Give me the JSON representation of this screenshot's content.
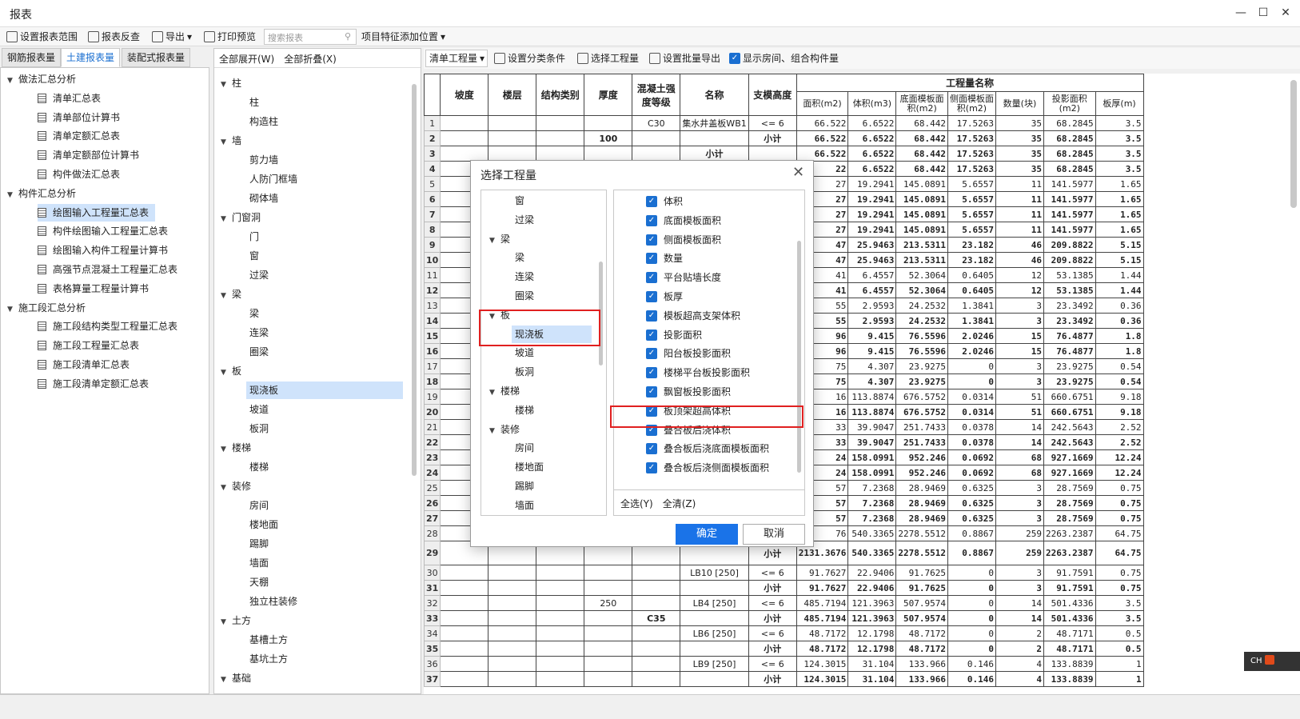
{
  "app_title": "报表",
  "toolbar": {
    "set_range": "设置报表范围",
    "reverse": "报表反查",
    "export": "导出",
    "print": "打印预览",
    "search_placeholder": "搜索报表",
    "feature_pos": "项目特征添加位置"
  },
  "tabs": [
    "钢筋报表量",
    "土建报表量",
    "装配式报表量"
  ],
  "left_tree": [
    {
      "label": "做法汇总分析",
      "group": true
    },
    {
      "label": "清单汇总表"
    },
    {
      "label": "清单部位计算书"
    },
    {
      "label": "清单定额汇总表"
    },
    {
      "label": "清单定额部位计算书"
    },
    {
      "label": "构件做法汇总表"
    },
    {
      "label": "构件汇总分析",
      "group": true
    },
    {
      "label": "绘图输入工程量汇总表",
      "selected": true
    },
    {
      "label": "构件绘图输入工程量汇总表"
    },
    {
      "label": "绘图输入构件工程量计算书"
    },
    {
      "label": "高强节点混凝土工程量汇总表"
    },
    {
      "label": "表格算量工程量计算书"
    },
    {
      "label": "施工段汇总分析",
      "group": true
    },
    {
      "label": "施工段结构类型工程量汇总表"
    },
    {
      "label": "施工段工程量汇总表"
    },
    {
      "label": "施工段清单汇总表"
    },
    {
      "label": "施工段清单定额汇总表"
    }
  ],
  "mid_head": {
    "expand": "全部展开(W)",
    "collapse": "全部折叠(X)"
  },
  "mid_tree": [
    {
      "label": "柱",
      "group": true
    },
    {
      "label": "柱"
    },
    {
      "label": "构造柱"
    },
    {
      "label": "墙",
      "group": true
    },
    {
      "label": "剪力墙"
    },
    {
      "label": "人防门框墙"
    },
    {
      "label": "砌体墙"
    },
    {
      "label": "门窗洞",
      "group": true
    },
    {
      "label": "门"
    },
    {
      "label": "窗"
    },
    {
      "label": "过梁"
    },
    {
      "label": "梁",
      "group": true
    },
    {
      "label": "梁"
    },
    {
      "label": "连梁"
    },
    {
      "label": "圈梁"
    },
    {
      "label": "板",
      "group": true
    },
    {
      "label": "现浇板",
      "selected": true
    },
    {
      "label": "坡道"
    },
    {
      "label": "板洞"
    },
    {
      "label": "楼梯",
      "group": true
    },
    {
      "label": "楼梯"
    },
    {
      "label": "装修",
      "group": true
    },
    {
      "label": "房间"
    },
    {
      "label": "楼地面"
    },
    {
      "label": "踢脚"
    },
    {
      "label": "墙面"
    },
    {
      "label": "天棚"
    },
    {
      "label": "独立柱装修"
    },
    {
      "label": "土方",
      "group": true
    },
    {
      "label": "基槽土方"
    },
    {
      "label": "基坑土方"
    },
    {
      "label": "基础",
      "group": true
    }
  ],
  "right_toolbar": {
    "combo": "清单工程量",
    "classify": "设置分类条件",
    "select_qty": "选择工程量",
    "batch_export": "设置批量导出",
    "show_room": "显示房间、组合构件量"
  },
  "table": {
    "headers": [
      "坡度",
      "楼层",
      "结构类别",
      "厚度",
      "混凝土强度等级",
      "名称",
      "支模高度"
    ],
    "group_header": "工程量名称",
    "qty_headers": [
      "面积(m2)",
      "体积(m3)",
      "底面模板面积(m2)",
      "侧面模板面积(m2)",
      "数量(块)",
      "投影面积(m2)",
      "板厚(m)"
    ],
    "rows": [
      {
        "thick": "",
        "grade": "C30",
        "name": "集水井盖板WB1",
        "h": "<= 6",
        "v": [
          "66.522",
          "6.6522",
          "68.442",
          "17.5263",
          "35",
          "68.2845",
          "3.5"
        ]
      },
      {
        "thick": "100",
        "grade": "",
        "name": "",
        "h": "小计",
        "v": [
          "66.522",
          "6.6522",
          "68.442",
          "17.5263",
          "35",
          "68.2845",
          "3.5"
        ],
        "bold": true
      },
      {
        "thick": "",
        "grade": "",
        "name": "小计",
        "h": "",
        "v": [
          "66.522",
          "6.6522",
          "68.442",
          "17.5263",
          "35",
          "68.2845",
          "3.5"
        ],
        "bold": true
      },
      {
        "v": [
          "22",
          "6.6522",
          "68.442",
          "17.5263",
          "35",
          "68.2845",
          "3.5"
        ],
        "bold": true
      },
      {
        "v": [
          "27",
          "19.2941",
          "145.0891",
          "5.6557",
          "11",
          "141.5977",
          "1.65"
        ]
      },
      {
        "v": [
          "27",
          "19.2941",
          "145.0891",
          "5.6557",
          "11",
          "141.5977",
          "1.65"
        ],
        "bold": true
      },
      {
        "v": [
          "27",
          "19.2941",
          "145.0891",
          "5.6557",
          "11",
          "141.5977",
          "1.65"
        ],
        "bold": true
      },
      {
        "v": [
          "27",
          "19.2941",
          "145.0891",
          "5.6557",
          "11",
          "141.5977",
          "1.65"
        ],
        "bold": true
      },
      {
        "v": [
          "47",
          "25.9463",
          "213.5311",
          "23.182",
          "46",
          "209.8822",
          "5.15"
        ],
        "bold": true
      },
      {
        "v": [
          "47",
          "25.9463",
          "213.5311",
          "23.182",
          "46",
          "209.8822",
          "5.15"
        ],
        "bold": true
      },
      {
        "v": [
          "41",
          "6.4557",
          "52.3064",
          "0.6405",
          "12",
          "53.1385",
          "1.44"
        ]
      },
      {
        "v": [
          "41",
          "6.4557",
          "52.3064",
          "0.6405",
          "12",
          "53.1385",
          "1.44"
        ],
        "bold": true
      },
      {
        "v": [
          "55",
          "2.9593",
          "24.2532",
          "1.3841",
          "3",
          "23.3492",
          "0.36"
        ]
      },
      {
        "v": [
          "55",
          "2.9593",
          "24.2532",
          "1.3841",
          "3",
          "23.3492",
          "0.36"
        ],
        "bold": true
      },
      {
        "v": [
          "96",
          "9.415",
          "76.5596",
          "2.0246",
          "15",
          "76.4877",
          "1.8"
        ],
        "bold": true
      },
      {
        "v": [
          "96",
          "9.415",
          "76.5596",
          "2.0246",
          "15",
          "76.4877",
          "1.8"
        ],
        "bold": true
      },
      {
        "v": [
          "75",
          "4.307",
          "23.9275",
          "0",
          "3",
          "23.9275",
          "0.54"
        ]
      },
      {
        "v": [
          "75",
          "4.307",
          "23.9275",
          "0",
          "3",
          "23.9275",
          "0.54"
        ],
        "bold": true
      },
      {
        "v": [
          "16",
          "113.8874",
          "676.5752",
          "0.0314",
          "51",
          "660.6751",
          "9.18"
        ]
      },
      {
        "v": [
          "16",
          "113.8874",
          "676.5752",
          "0.0314",
          "51",
          "660.6751",
          "9.18"
        ],
        "bold": true
      },
      {
        "v": [
          "33",
          "39.9047",
          "251.7433",
          "0.0378",
          "14",
          "242.5643",
          "2.52"
        ]
      },
      {
        "v": [
          "33",
          "39.9047",
          "251.7433",
          "0.0378",
          "14",
          "242.5643",
          "2.52"
        ],
        "bold": true
      },
      {
        "v": [
          "24",
          "158.0991",
          "952.246",
          "0.0692",
          "68",
          "927.1669",
          "12.24"
        ],
        "bold": true
      },
      {
        "v": [
          "24",
          "158.0991",
          "952.246",
          "0.0692",
          "68",
          "927.1669",
          "12.24"
        ],
        "bold": true
      },
      {
        "v": [
          "57",
          "7.2368",
          "28.9469",
          "0.6325",
          "3",
          "28.7569",
          "0.75"
        ]
      },
      {
        "v": [
          "57",
          "7.2368",
          "28.9469",
          "0.6325",
          "3",
          "28.7569",
          "0.75"
        ],
        "bold": true
      },
      {
        "v": [
          "57",
          "7.2368",
          "28.9469",
          "0.6325",
          "3",
          "28.7569",
          "0.75"
        ],
        "bold": true
      },
      {
        "v": [
          "76",
          "540.3365",
          "2278.5512",
          "0.8867",
          "259",
          "2263.2387",
          "64.75"
        ]
      },
      {
        "thick": "",
        "grade": "",
        "name": "",
        "h": "小计",
        "v": [
          "2131.3676",
          "540.3365",
          "2278.5512",
          "0.8867",
          "259",
          "2263.2387",
          "64.75"
        ],
        "bold": true
      },
      {
        "thick": "",
        "grade": "",
        "name": "LB10 [250]",
        "h": "<= 6",
        "v": [
          "91.7627",
          "22.9406",
          "91.7625",
          "0",
          "3",
          "91.7591",
          "0.75"
        ]
      },
      {
        "thick": "",
        "grade": "",
        "name": "",
        "h": "小计",
        "v": [
          "91.7627",
          "22.9406",
          "91.7625",
          "0",
          "3",
          "91.7591",
          "0.75"
        ],
        "bold": true
      },
      {
        "thick": "250",
        "grade": "",
        "name": "LB4 [250]",
        "h": "<= 6",
        "v": [
          "485.7194",
          "121.3963",
          "507.9574",
          "0",
          "14",
          "501.4336",
          "3.5"
        ]
      },
      {
        "thick": "",
        "grade": "C35",
        "name": "",
        "h": "小计",
        "v": [
          "485.7194",
          "121.3963",
          "507.9574",
          "0",
          "14",
          "501.4336",
          "3.5"
        ],
        "bold": true
      },
      {
        "thick": "",
        "grade": "",
        "name": "LB6 [250]",
        "h": "<= 6",
        "v": [
          "48.7172",
          "12.1798",
          "48.7172",
          "0",
          "2",
          "48.7171",
          "0.5"
        ]
      },
      {
        "thick": "",
        "grade": "",
        "name": "",
        "h": "小计",
        "v": [
          "48.7172",
          "12.1798",
          "48.7172",
          "0",
          "2",
          "48.7171",
          "0.5"
        ],
        "bold": true
      },
      {
        "thick": "",
        "grade": "",
        "name": "LB9 [250]",
        "h": "<= 6",
        "v": [
          "124.3015",
          "31.104",
          "133.966",
          "0.146",
          "4",
          "133.8839",
          "1"
        ]
      },
      {
        "thick": "",
        "grade": "",
        "name": "",
        "h": "小计",
        "v": [
          "124.3015",
          "31.104",
          "133.966",
          "0.146",
          "4",
          "133.8839",
          "1"
        ],
        "bold": true
      }
    ]
  },
  "dialog": {
    "title": "选择工程量",
    "left_tree": [
      {
        "label": "窗",
        "indent": 2
      },
      {
        "label": "过梁",
        "indent": 2
      },
      {
        "label": "梁",
        "indent": 1,
        "group": true
      },
      {
        "label": "梁",
        "indent": 2
      },
      {
        "label": "连梁",
        "indent": 2
      },
      {
        "label": "圈梁",
        "indent": 2
      },
      {
        "label": "板",
        "indent": 1,
        "group": true
      },
      {
        "label": "现浇板",
        "indent": 2,
        "selected": true
      },
      {
        "label": "坡道",
        "indent": 2
      },
      {
        "label": "板洞",
        "indent": 2
      },
      {
        "label": "楼梯",
        "indent": 1,
        "group": true
      },
      {
        "label": "楼梯",
        "indent": 2
      },
      {
        "label": "装修",
        "indent": 1,
        "group": true
      },
      {
        "label": "房间",
        "indent": 2
      },
      {
        "label": "楼地面",
        "indent": 2
      },
      {
        "label": "踢脚",
        "indent": 2
      },
      {
        "label": "墙面",
        "indent": 2
      }
    ],
    "checks": [
      "体积",
      "底面模板面积",
      "侧面模板面积",
      "数量",
      "平台贴墙长度",
      "板厚",
      "模板超高支架体积",
      "投影面积",
      "阳台板投影面积",
      "楼梯平台板投影面积",
      "飘窗板投影面积",
      "板顶架超高体积",
      "叠合板后浇体积",
      "叠合板后浇底面模板面积",
      "叠合板后浇侧面模板面积"
    ],
    "select_all": "全选(Y)",
    "clear_all": "全清(Z)",
    "ok": "确定",
    "cancel": "取消"
  },
  "status": {
    "ime": "CH"
  }
}
